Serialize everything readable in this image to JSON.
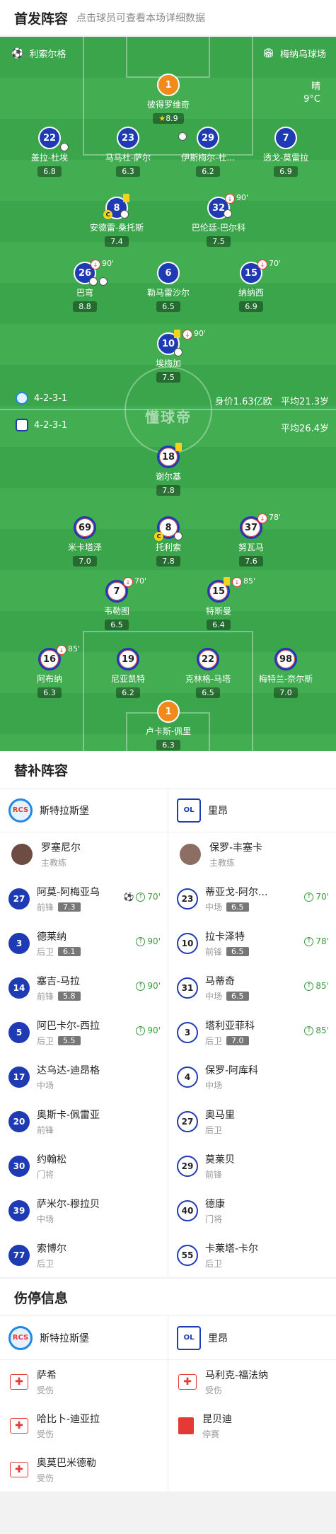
{
  "header": {
    "title": "首发阵容",
    "subtitle": "点击球员可查看本场详细数据"
  },
  "pitch": {
    "home_team": "利索尔格",
    "venue": "梅纳乌球场",
    "weather": "晴",
    "temp": "9°C",
    "home_formation": "4-2-3-1",
    "home_value": "身价1.63亿欧",
    "home_age": "平均21.3岁",
    "away_formation": "4-2-3-1",
    "away_age": "平均26.4岁",
    "watermark": "懂球帝"
  },
  "home_players": [
    {
      "n": "1",
      "name": "彼得罗维奇",
      "rating": "8.9",
      "gk": true
    },
    {
      "n": "22",
      "name": "盖拉-杜埃",
      "rating": "6.8"
    },
    {
      "n": "23",
      "name": "马马杜-萨尔",
      "rating": "6.3"
    },
    {
      "n": "29",
      "name": "伊斯梅尔-杜...",
      "rating": "6.2"
    },
    {
      "n": "7",
      "name": "透戈-莫雷拉",
      "rating": "6.9"
    },
    {
      "n": "8",
      "name": "安德雷-桑托斯",
      "rating": "7.4"
    },
    {
      "n": "32",
      "name": "巴伦廷-巴尔科",
      "rating": "7.5",
      "sub": "90'"
    },
    {
      "n": "26",
      "name": "巴弯",
      "rating": "8.8",
      "sub": "90'"
    },
    {
      "n": "6",
      "name": "勒马雷沙尔",
      "rating": "6.5"
    },
    {
      "n": "15",
      "name": "纳纳西",
      "rating": "6.9",
      "sub": "70'"
    },
    {
      "n": "10",
      "name": "埃梅加",
      "rating": "7.5",
      "sub": "90'"
    }
  ],
  "away_players": [
    {
      "n": "18",
      "name": "谢尔基",
      "rating": "7.8"
    },
    {
      "n": "69",
      "name": "米卡塔泽",
      "rating": "7.0"
    },
    {
      "n": "8",
      "name": "托利索",
      "rating": "7.8"
    },
    {
      "n": "37",
      "name": "努瓦马",
      "rating": "7.6",
      "sub": "78'"
    },
    {
      "n": "7",
      "name": "韦勒图",
      "rating": "6.5",
      "sub": "70'"
    },
    {
      "n": "15",
      "name": "特斯曼",
      "rating": "6.4",
      "sub": "85'"
    },
    {
      "n": "16",
      "name": "阿布纳",
      "rating": "6.3",
      "sub": "85'"
    },
    {
      "n": "19",
      "name": "尼亚凯特",
      "rating": "6.2"
    },
    {
      "n": "22",
      "name": "克林格-马塔",
      "rating": "6.5"
    },
    {
      "n": "98",
      "name": "梅特兰-奈尔斯",
      "rating": "7.0"
    },
    {
      "n": "1",
      "name": "卢卡斯-佩里",
      "rating": "6.3",
      "gk": true
    }
  ],
  "subs": {
    "title": "替补阵容",
    "home": {
      "team": "斯特拉斯堡",
      "logo": "RCS",
      "coach": "罗塞尼尔",
      "coach_role": "主教练",
      "players": [
        {
          "n": "27",
          "name": "阿莫-阿梅亚乌",
          "pos": "前锋",
          "rating": "7.3",
          "in": "70'"
        },
        {
          "n": "3",
          "name": "德莱纳",
          "pos": "后卫",
          "rating": "6.1",
          "in": "90'"
        },
        {
          "n": "14",
          "name": "塞吉-马拉",
          "pos": "前锋",
          "rating": "5.8",
          "in": "90'"
        },
        {
          "n": "5",
          "name": "阿巴卡尔-西拉",
          "pos": "后卫",
          "rating": "5.5",
          "in": "90'"
        },
        {
          "n": "17",
          "name": "达乌达-迪昂格",
          "pos": "中场"
        },
        {
          "n": "20",
          "name": "奥斯卡-佩雷亚",
          "pos": "前锋"
        },
        {
          "n": "30",
          "name": "约翰松",
          "pos": "门将"
        },
        {
          "n": "39",
          "name": "萨米尔-穆拉贝",
          "pos": "中场"
        },
        {
          "n": "77",
          "name": "索博尔",
          "pos": "后卫"
        }
      ]
    },
    "away": {
      "team": "里昂",
      "logo": "OL",
      "coach": "保罗-丰塞卡",
      "coach_role": "主教练",
      "players": [
        {
          "n": "23",
          "name": "蒂亚戈-阿尔...",
          "pos": "中场",
          "rating": "6.5",
          "in": "70'"
        },
        {
          "n": "10",
          "name": "拉卡泽特",
          "pos": "前锋",
          "rating": "6.5",
          "in": "78'"
        },
        {
          "n": "31",
          "name": "马蒂奇",
          "pos": "中场",
          "rating": "6.5",
          "in": "85'"
        },
        {
          "n": "3",
          "name": "塔利亚菲科",
          "pos": "后卫",
          "rating": "7.0",
          "in": "85'"
        },
        {
          "n": "4",
          "name": "保罗-阿库科",
          "pos": "中场"
        },
        {
          "n": "27",
          "name": "奥马里",
          "pos": "后卫"
        },
        {
          "n": "29",
          "name": "莫莱贝",
          "pos": "前锋"
        },
        {
          "n": "40",
          "name": "德康",
          "pos": "门将"
        },
        {
          "n": "55",
          "name": "卡莱塔-卡尔",
          "pos": "后卫"
        }
      ]
    }
  },
  "injuries": {
    "title": "伤停信息",
    "home": {
      "team": "斯特拉斯堡",
      "players": [
        {
          "name": "萨希",
          "status": "受伤"
        },
        {
          "name": "哈比卜-迪亚拉",
          "status": "受伤"
        },
        {
          "name": "奥莫巴米德勒",
          "status": "受伤"
        }
      ]
    },
    "away": {
      "team": "里昂",
      "players": [
        {
          "name": "马利克-福法纳",
          "status": "受伤"
        },
        {
          "name": "昆贝迪",
          "status": "停赛"
        }
      ]
    }
  }
}
